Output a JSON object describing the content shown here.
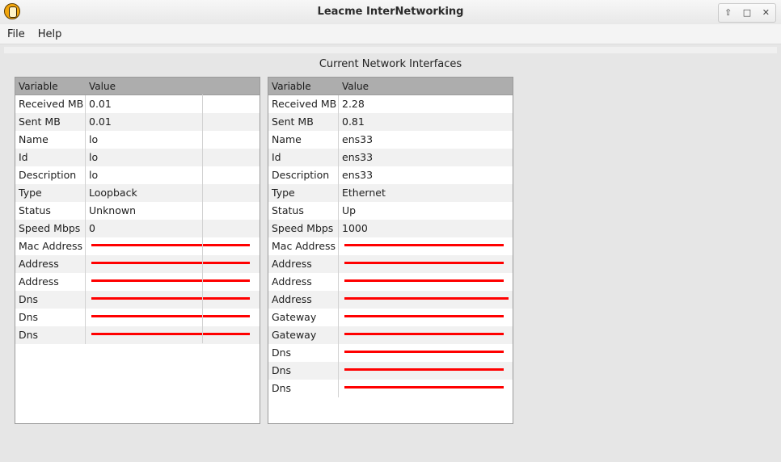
{
  "window": {
    "title": "Leacme InterNetworking"
  },
  "menu": [
    "File",
    "Help"
  ],
  "caption": "Current Network Interfaces",
  "columns": {
    "variable": "Variable",
    "value": "Value"
  },
  "left_table": [
    {
      "var": "Received MB",
      "val": "0.01"
    },
    {
      "var": "Sent MB",
      "val": "0.01"
    },
    {
      "var": "Name",
      "val": "lo"
    },
    {
      "var": "Id",
      "val": "lo"
    },
    {
      "var": "Description",
      "val": "lo"
    },
    {
      "var": "Type",
      "val": "Loopback"
    },
    {
      "var": "Status",
      "val": "Unknown"
    },
    {
      "var": "Speed Mbps",
      "val": "0"
    },
    {
      "var": "Mac Address",
      "redacted": true
    },
    {
      "var": "Address",
      "redacted": true
    },
    {
      "var": "Address",
      "redacted": true
    },
    {
      "var": "Dns",
      "redacted": true
    },
    {
      "var": "Dns",
      "redacted": true
    },
    {
      "var": "Dns",
      "redacted": true
    }
  ],
  "right_table": [
    {
      "var": "Received MB",
      "val": "2.28"
    },
    {
      "var": "Sent MB",
      "val": "0.81"
    },
    {
      "var": "Name",
      "val": "ens33"
    },
    {
      "var": "Id",
      "val": "ens33"
    },
    {
      "var": "Description",
      "val": "ens33"
    },
    {
      "var": "Type",
      "val": "Ethernet"
    },
    {
      "var": "Status",
      "val": "Up"
    },
    {
      "var": "Speed Mbps",
      "val": "1000"
    },
    {
      "var": "Mac Address",
      "redacted": true
    },
    {
      "var": "Address",
      "redacted": true
    },
    {
      "var": "Address",
      "redacted": true
    },
    {
      "var": "Address",
      "redacted": true
    },
    {
      "var": "Gateway",
      "redacted": true
    },
    {
      "var": "Gateway",
      "redacted": true
    },
    {
      "var": "Dns",
      "redacted": true
    },
    {
      "var": "Dns",
      "redacted": true
    },
    {
      "var": "Dns",
      "redacted": true
    }
  ],
  "colors": {
    "redaction": "#ff0000",
    "header_bg": "#adadad"
  }
}
